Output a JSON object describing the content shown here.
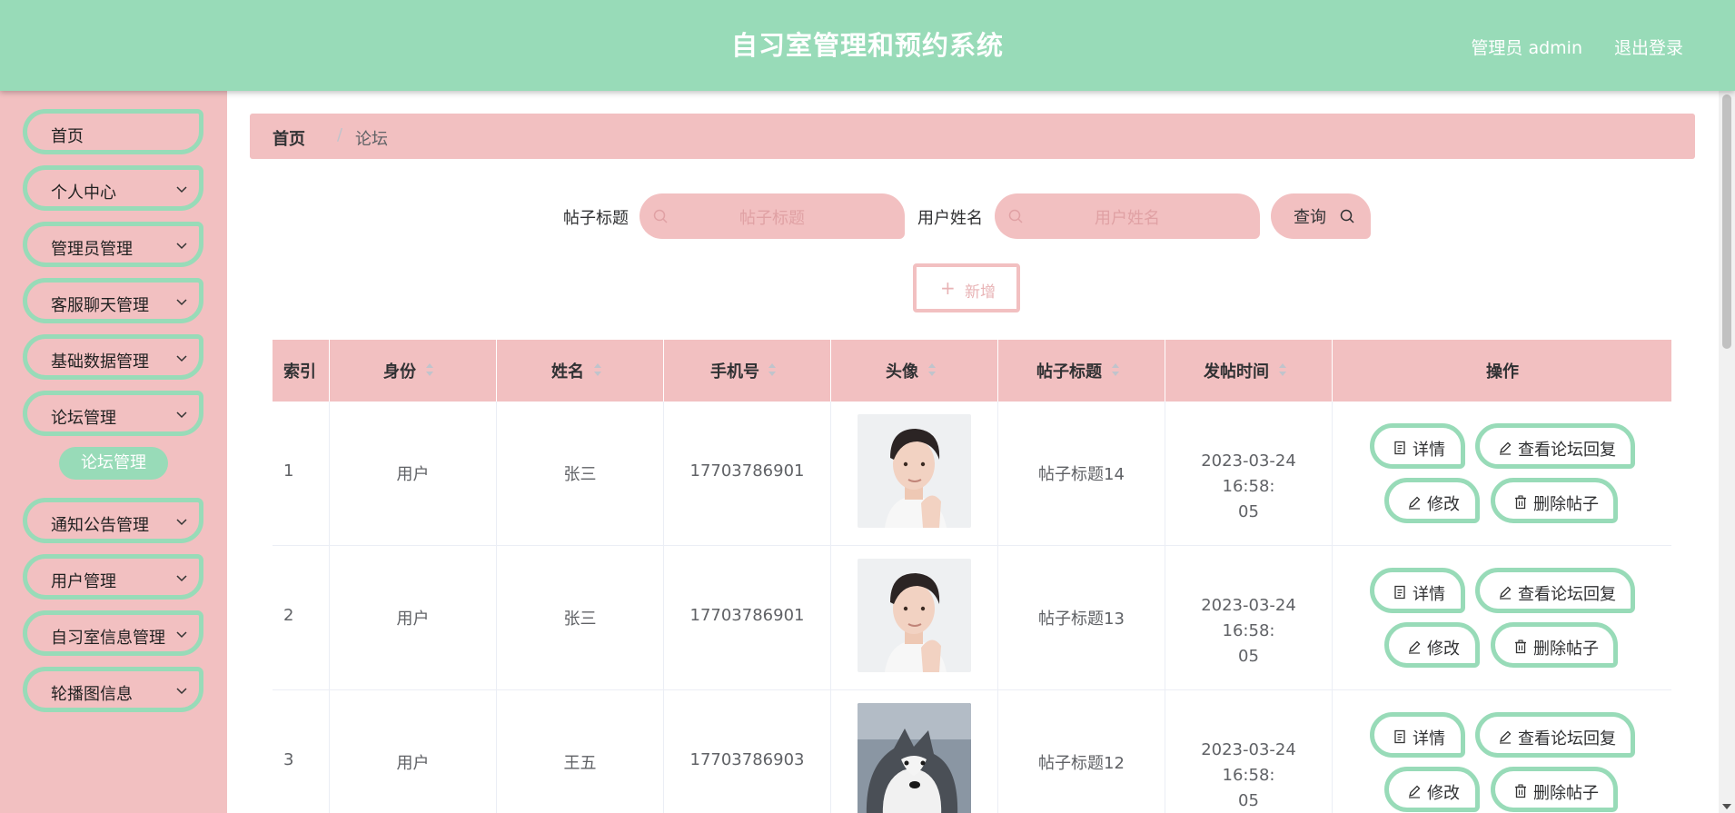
{
  "header": {
    "title": "自习室管理和预约系统",
    "user": "管理员 admin",
    "logout": "退出登录"
  },
  "sidebar": {
    "items": [
      {
        "label": "首页"
      },
      {
        "label": "个人中心"
      },
      {
        "label": "管理员管理"
      },
      {
        "label": "客服聊天管理"
      },
      {
        "label": "基础数据管理"
      },
      {
        "label": "论坛管理"
      },
      {
        "label": "通知公告管理"
      },
      {
        "label": "用户管理"
      },
      {
        "label": "自习室信息管理"
      },
      {
        "label": "轮播图信息"
      }
    ],
    "active_sub": "论坛管理"
  },
  "breadcrumb": {
    "home": "首页",
    "separator": "/",
    "current": "论坛"
  },
  "search": {
    "title_label": "帖子标题",
    "title_placeholder": "帖子标题",
    "name_label": "用户姓名",
    "name_placeholder": "用户姓名",
    "query_button": "查询"
  },
  "add_button": "新增",
  "table": {
    "headers": [
      "索引",
      "身份",
      "姓名",
      "手机号",
      "头像",
      "帖子标题",
      "发帖时间",
      "操作"
    ],
    "rows": [
      {
        "index": "1",
        "role": "用户",
        "name": "张三",
        "phone": "17703786901",
        "avatar": "avatar-young-man",
        "title": "帖子标题14",
        "time_line1": "2023-03-24 16:58:",
        "time_line2": "05"
      },
      {
        "index": "2",
        "role": "用户",
        "name": "张三",
        "phone": "17703786901",
        "avatar": "avatar-young-man",
        "title": "帖子标题13",
        "time_line1": "2023-03-24 16:58:",
        "time_line2": "05"
      },
      {
        "index": "3",
        "role": "用户",
        "name": "王五",
        "phone": "17703786903",
        "avatar": "avatar-husky-dog",
        "title": "帖子标题12",
        "time_line1": "2023-03-24 16:58:",
        "time_line2": "05"
      }
    ],
    "actions": {
      "detail": "详情",
      "view_replies": "查看论坛回复",
      "edit": "修改",
      "delete": "删除帖子"
    }
  },
  "colors": {
    "primary_green": "#98dbb8",
    "primary_pink": "#f2c0c1",
    "placeholder_pink": "#e0a1a4"
  }
}
